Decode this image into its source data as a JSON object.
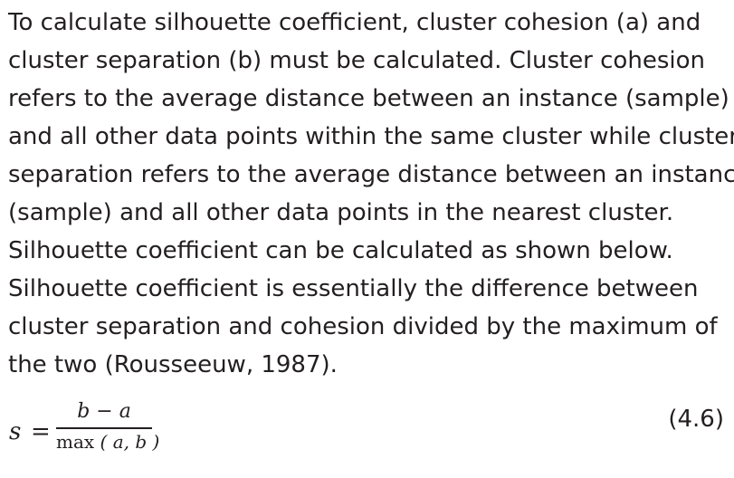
{
  "paragraph": {
    "lines": [
      "To calculate silhouette coefficient, cluster cohesion (a) and",
      "cluster separation (b) must be calculated. Cluster cohesion",
      "refers to the average distance between an instance (sample)",
      "and all other data points within the same cluster while cluster",
      "separation refers to the average distance between an instance",
      "(sample) and all other data points in the nearest cluster.",
      "Silhouette coefficient can be calculated as shown below.",
      "Silhouette coefficient is essentially the difference between",
      "cluster separation and cohesion divided by the maximum of",
      "the two (Rousseeuw, 1987)."
    ]
  },
  "equation": {
    "lhs": "s",
    "equals": "=",
    "numerator": "b − a",
    "denominator_func": "max",
    "denominator_args": "( a, b )",
    "number": "(4.6)"
  }
}
